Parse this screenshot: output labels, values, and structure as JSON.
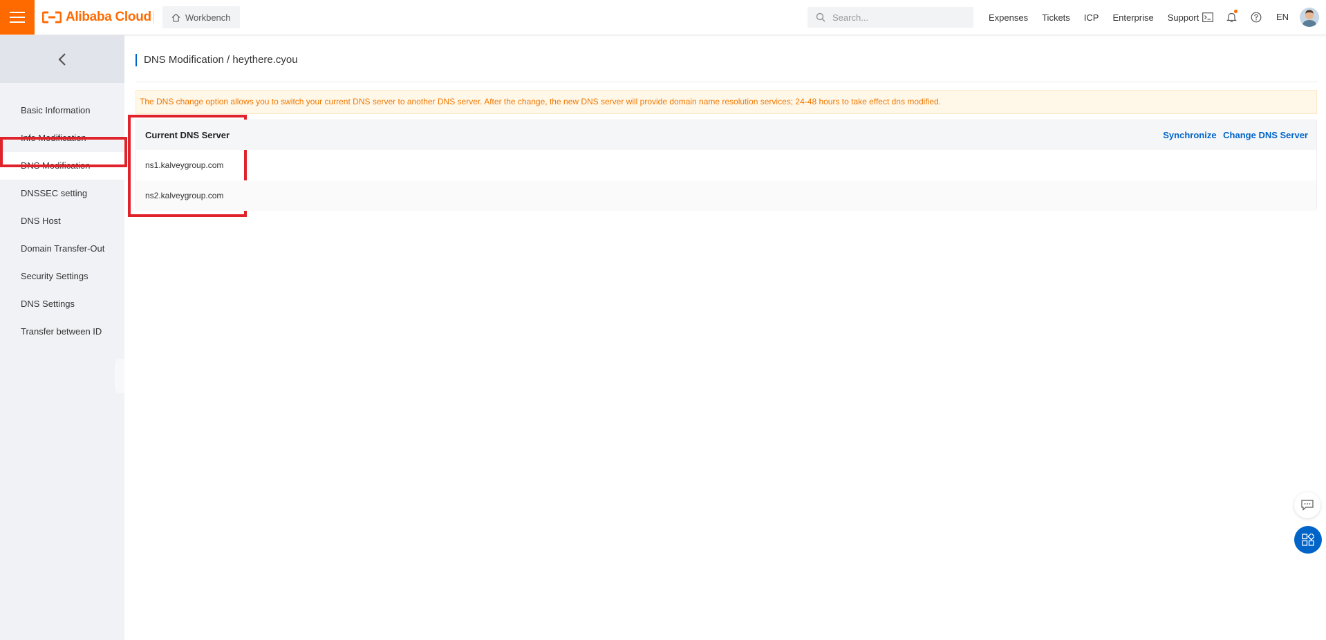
{
  "header": {
    "logo_text": "Alibaba Cloud",
    "workbench_label": "Workbench",
    "search_placeholder": "Search...",
    "nav_links": [
      "Expenses",
      "Tickets",
      "ICP",
      "Enterprise",
      "Support"
    ],
    "language": "EN",
    "brand_color": "#ff6a00"
  },
  "sidebar": {
    "items": [
      {
        "label": "Basic Information"
      },
      {
        "label": "Info Modification"
      },
      {
        "label": "DNS Modification",
        "active": true
      },
      {
        "label": "DNSSEC setting"
      },
      {
        "label": "DNS Host"
      },
      {
        "label": "Domain Transfer-Out"
      },
      {
        "label": "Security Settings"
      },
      {
        "label": "DNS Settings"
      },
      {
        "label": "Transfer between ID"
      }
    ]
  },
  "main": {
    "page_title": "DNS Modification / heythere.cyou",
    "notice": "The DNS change option allows you to switch your current DNS server to another DNS server. After the change, the new DNS server will provide domain name resolution services; 24-48 hours to take effect dns modified.",
    "dns_table": {
      "header": "Current DNS Server",
      "sync_label": "Synchronize",
      "change_label": "Change DNS Server",
      "servers": [
        "ns1.kalveygroup.com",
        "ns2.kalveygroup.com"
      ]
    }
  },
  "colors": {
    "accent": "#0064c8",
    "highlight": "#e0222b",
    "notice_text": "#f07800"
  }
}
